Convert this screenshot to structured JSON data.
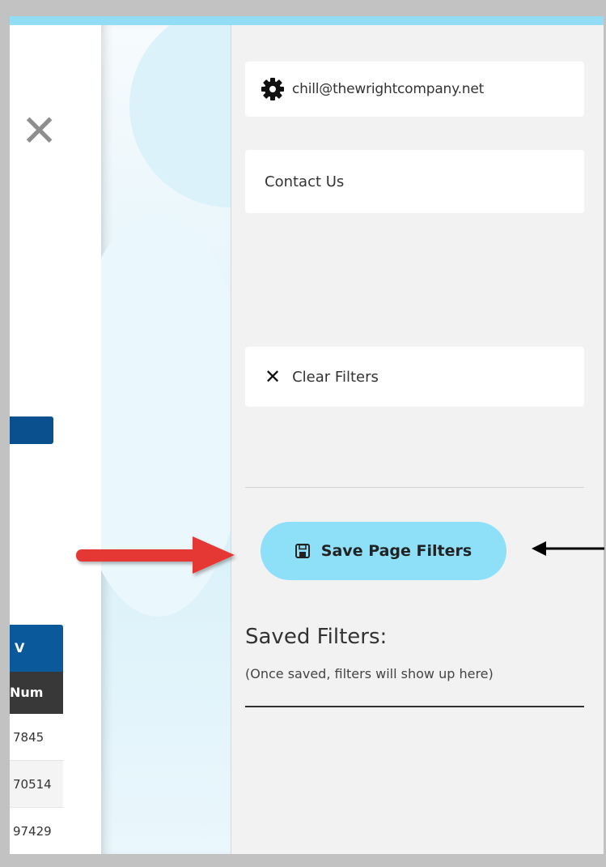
{
  "left_page": {
    "close_glyph": "✕",
    "table": {
      "header_top": "V",
      "header_bottom": "Num",
      "rows": [
        "7845",
        "70514",
        "97429"
      ]
    }
  },
  "panel": {
    "user_email": "chill@thewrightcompany.net",
    "contact_label": "Contact Us",
    "clear_filters_label": "Clear Filters",
    "save_filters_label": "Save Page Filters",
    "saved_filters_title": "Saved Filters:",
    "saved_filters_hint": "(Once saved, filters will show up here)"
  },
  "icons": {
    "gear": "gear-icon",
    "clear": "close-icon",
    "save": "save-icon"
  },
  "colors": {
    "accent": "#8ee0f9",
    "top_strip": "#93dcf6",
    "panel_bg": "#f2f2f2",
    "table_header": "#0a5a9b",
    "annotation_arrow": "#e53935"
  }
}
